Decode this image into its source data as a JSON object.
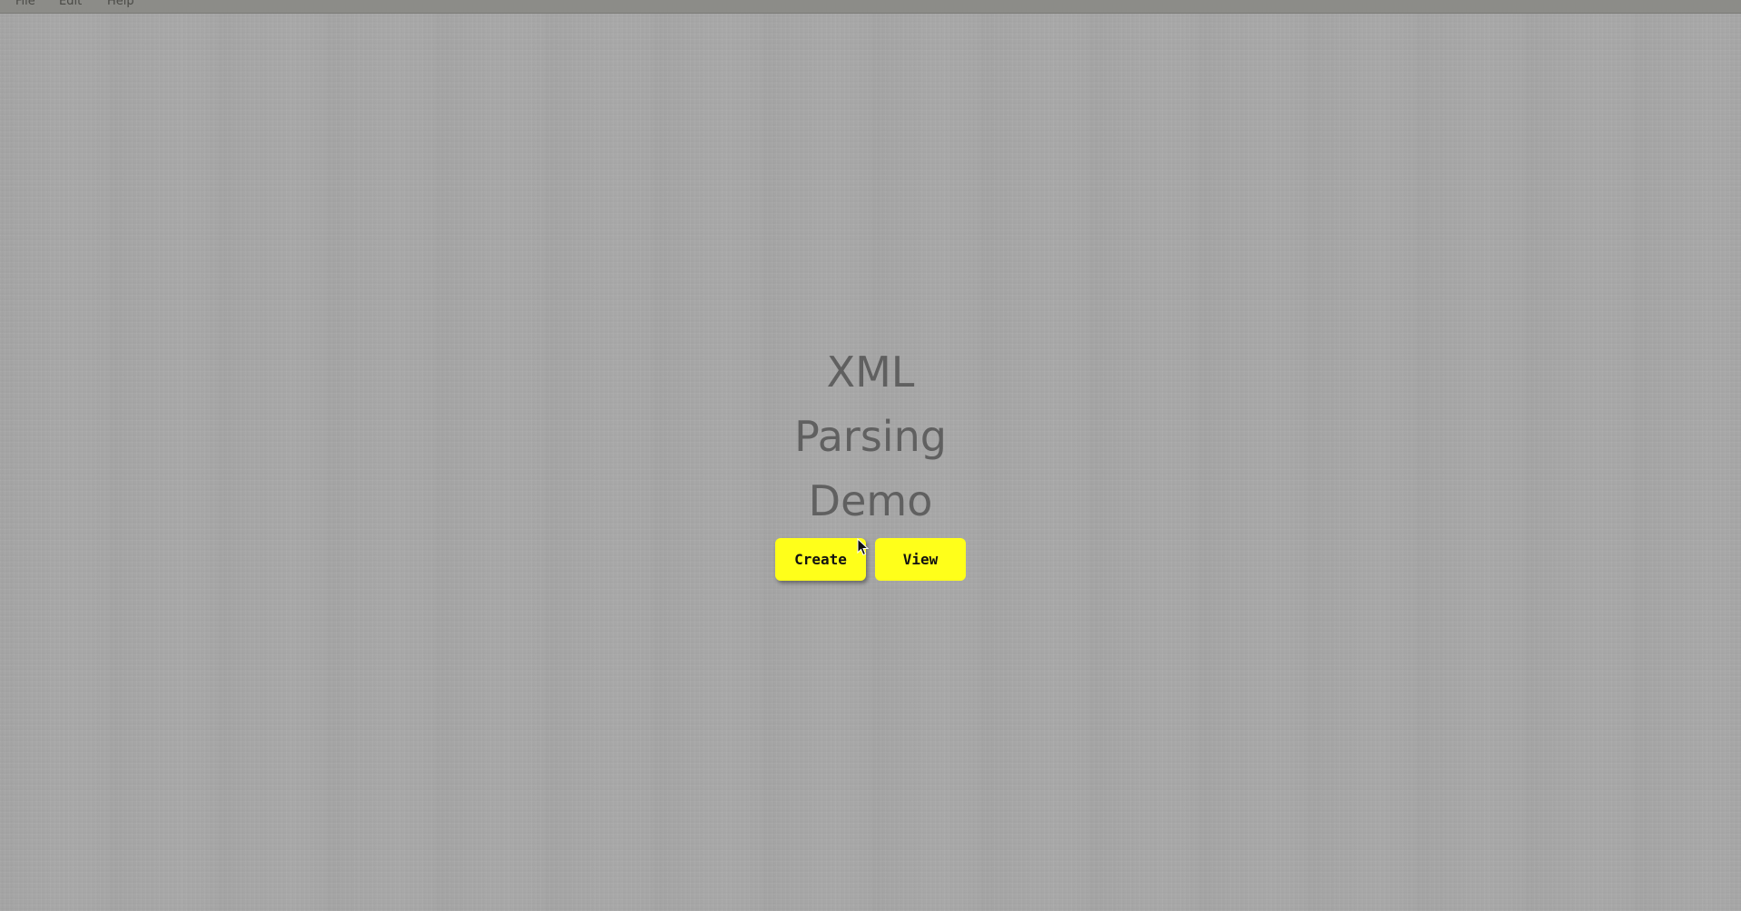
{
  "menubar": {
    "items": [
      {
        "label": "File"
      },
      {
        "label": "Edit"
      },
      {
        "label": "Help"
      }
    ]
  },
  "main": {
    "title_lines": [
      "XML",
      "Parsing",
      "Demo"
    ],
    "buttons": {
      "create_label": "Create",
      "view_label": "View"
    }
  },
  "colors": {
    "button_bg": "#ffff1a",
    "background": "#a6a6a6",
    "title_text": "#606060"
  },
  "icons": {
    "cursor": "mouse-pointer-icon"
  }
}
